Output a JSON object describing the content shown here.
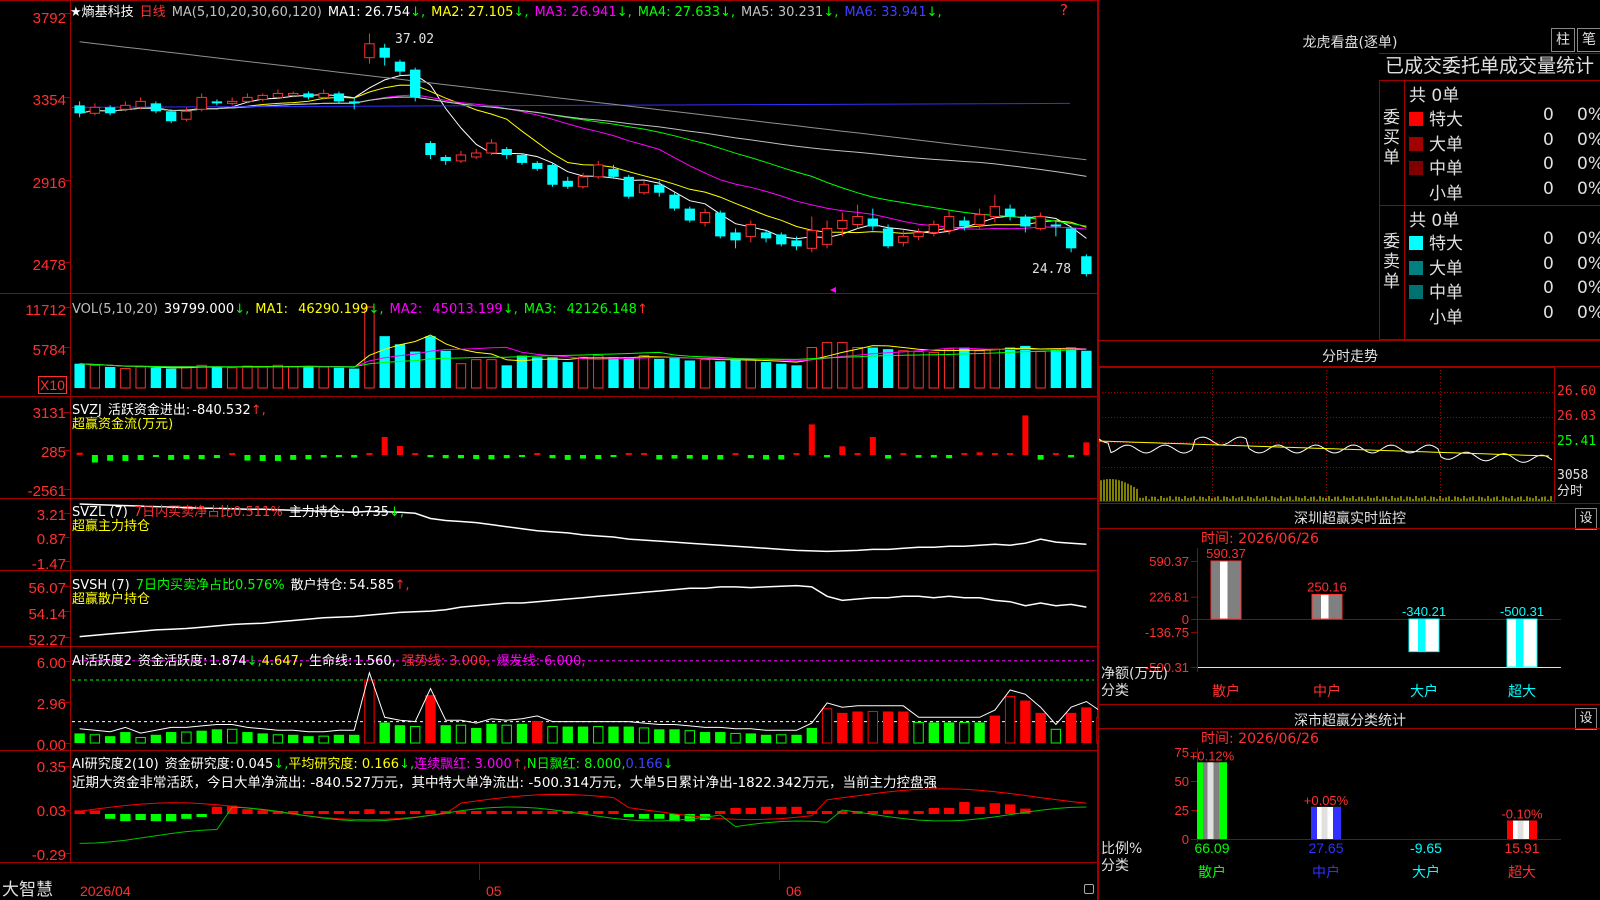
{
  "stock": {
    "star": "★",
    "name": "熵基科技",
    "period": "日线",
    "ma_spec": "MA(5,10,20,30,60,120)",
    "ma": [
      {
        "label": "MA1:",
        "value": "26.754",
        "arrow": "↓",
        "color": "#ffffff"
      },
      {
        "label": "MA2:",
        "value": "27.105",
        "arrow": "↓",
        "color": "#ffff00"
      },
      {
        "label": "MA3:",
        "value": "26.941",
        "arrow": "↓",
        "color": "#ff00ff"
      },
      {
        "label": "MA4:",
        "value": "27.633",
        "arrow": "↓",
        "color": "#00ff00"
      },
      {
        "label": "MA5:",
        "value": "30.231",
        "arrow": "↓",
        "color": "#c0c0c0"
      },
      {
        "label": "MA6:",
        "value": "33.941",
        "arrow": "↓",
        "color": "#4040ff"
      }
    ],
    "question_mark": "?",
    "high_mark": "37.02",
    "low_mark": "24.78"
  },
  "price_axis": [
    "3792",
    "3354",
    "2916",
    "2478"
  ],
  "vol": {
    "header": "VOL(5,10,20)",
    "value": "39799.000",
    "ma1": "46290.199",
    "ma2": "45013.199",
    "ma3": "42126.148",
    "axis": [
      "11712",
      "5784"
    ],
    "unit": "X10"
  },
  "svzj": {
    "name": "SVZJ",
    "label": "活跃资金进出:",
    "value": "-840.532",
    "arrow": "↑,",
    "sub": "超赢资金流(万元)",
    "axis": [
      "3131",
      "285",
      "-2561"
    ]
  },
  "svzl": {
    "name": "SVZL (7)",
    "desc": "7日内买卖净占比0.511%",
    "label": "主力持仓:",
    "value": "-0.735",
    "arrow": "↓,",
    "sub": "超赢主力持仓",
    "axis": [
      "3.21",
      "0.87",
      "-1.47"
    ]
  },
  "svsh": {
    "name": "SVSH (7)",
    "desc": "7日内买卖净占比0.576%",
    "label": "散户持仓:",
    "value": "54.585",
    "arrow": "↑,",
    "sub": "超赢散户持仓",
    "axis": [
      "56.07",
      "54.14",
      "52.27"
    ]
  },
  "ai1": {
    "name": "AI活跃度2",
    "label": "资金活跃度:",
    "value": "1.874",
    "arrow": "↓,",
    "v2": "4.647,",
    "life_label": "生命线:",
    "life": "1.560,",
    "strong": "强势线: 3.000,",
    "burst": "爆发线: 6.000,",
    "axis": [
      "6.00",
      "2.96",
      "0.00"
    ]
  },
  "ai2": {
    "name": "AI研究度2(10)",
    "label": "资金研究度:",
    "value": "0.045",
    "arrow": "↓,",
    "avg": "平均研究度: 0.166",
    "avg_arrow": "↓,",
    "cont": "连续飘红: 3.000",
    "cont_arrow": "↑,",
    "nday": "N日飘红: 8.000,",
    "last": "0.166",
    "last_arrow": "↓",
    "comment": "近期大资金非常活跃，今日大单净流出: -840.527万元，其中特大单净流出: -500.314万元，大单5日累计净出-1822.342万元，当前主力控盘强",
    "axis": [
      "0.35",
      "0.03",
      "-0.29"
    ]
  },
  "time_axis": {
    "logo": "大智慧",
    "labels": [
      "2026/04",
      "05",
      "06"
    ]
  },
  "lhb": {
    "title": "龙虎看盘(逐单)",
    "btn_bar": "柱",
    "btn_pen": "笔",
    "tabs_text": "已成交委托单成交量统计",
    "buy_label": "委买单",
    "sell_label": "委卖单",
    "buy_total": "共 0单",
    "sell_total": "共 0单",
    "buy_rows": [
      {
        "name": "特大",
        "count": "0",
        "pct": "0%",
        "color": "#ff0000"
      },
      {
        "name": "大单",
        "count": "0",
        "pct": "0%",
        "color": "#a00000"
      },
      {
        "name": "中单",
        "count": "0",
        "pct": "0%",
        "color": "#800000"
      },
      {
        "name": "小单",
        "count": "0",
        "pct": "0%",
        "color": ""
      }
    ],
    "sell_rows": [
      {
        "name": "特大",
        "count": "0",
        "pct": "0%",
        "color": "#00ffff"
      },
      {
        "name": "大单",
        "count": "0",
        "pct": "0%",
        "color": "#008080"
      },
      {
        "name": "中单",
        "count": "0",
        "pct": "0%",
        "color": "#007070"
      },
      {
        "name": "小单",
        "count": "0",
        "pct": "0%",
        "color": ""
      }
    ]
  },
  "fenshi": {
    "title": "分时走势",
    "axis": [
      "26.60",
      "26.03",
      "25.41"
    ],
    "vol": "3058",
    "unit": "分时"
  },
  "monitor": {
    "title": "深圳超赢实时监控",
    "btn": "设",
    "time": "时间: 2026/06/26",
    "axis": [
      "590.37",
      "226.81",
      "0",
      "-136.75",
      "-500.31"
    ],
    "ylabel": "净额(万元)",
    "xlabel": "分类",
    "bars": [
      {
        "cat": "散户",
        "value": 590.37,
        "label": "590.37",
        "cat_color": "#ff3030"
      },
      {
        "cat": "中户",
        "value": 250.16,
        "label": "250.16",
        "cat_color": "#ff3030"
      },
      {
        "cat": "大户",
        "value": -340.21,
        "label": "-340.21",
        "cat_color": "#00ffff"
      },
      {
        "cat": "超大",
        "value": -500.31,
        "label": "-500.31",
        "cat_color": "#00ffff"
      }
    ]
  },
  "classify": {
    "title": "深市超赢分类统计",
    "btn": "设",
    "time": "时间: 2026/06/26",
    "axis": [
      "75",
      "50",
      "25",
      "0"
    ],
    "ylabel": "比例%",
    "xlabel": "分类",
    "bars": [
      {
        "cat": "散户",
        "value": 66.09,
        "label": "66.09",
        "top": "+0.12%",
        "cat_color": "#00ff00"
      },
      {
        "cat": "中户",
        "value": 27.65,
        "label": "27.65",
        "top": "+0.05%",
        "cat_color": "#3030ff"
      },
      {
        "cat": "大户",
        "value": 0,
        "label": "-9.65",
        "top": "",
        "cat_color": "#00ffff"
      },
      {
        "cat": "超大",
        "value": 15.91,
        "label": "15.91",
        "top": "-0.10%",
        "cat_color": "#ff3030"
      }
    ]
  },
  "chart_data": {
    "type": "candlestick",
    "ylim": [
      24.0,
      38.0
    ],
    "candles": [
      [
        33.4,
        33.0,
        33.6,
        32.8
      ],
      [
        33.0,
        33.3,
        33.5,
        32.9
      ],
      [
        33.3,
        33.0,
        33.4,
        32.9
      ],
      [
        33.2,
        33.4,
        33.6,
        33.1
      ],
      [
        33.3,
        33.6,
        33.8,
        33.2
      ],
      [
        33.5,
        33.1,
        33.6,
        33.0
      ],
      [
        33.1,
        32.6,
        33.2,
        32.5
      ],
      [
        32.7,
        33.1,
        33.3,
        32.6
      ],
      [
        33.2,
        33.8,
        34.0,
        33.1
      ],
      [
        33.6,
        33.5,
        33.7,
        33.4
      ],
      [
        33.5,
        33.6,
        33.8,
        33.4
      ],
      [
        33.6,
        33.8,
        34.0,
        33.5
      ],
      [
        33.7,
        33.9,
        34.0,
        33.6
      ],
      [
        33.8,
        34.0,
        34.2,
        33.7
      ],
      [
        33.9,
        34.0,
        34.1,
        33.8
      ],
      [
        34.0,
        33.8,
        34.1,
        33.7
      ],
      [
        33.8,
        34.0,
        34.2,
        33.7
      ],
      [
        34.0,
        33.6,
        34.1,
        33.5
      ],
      [
        33.6,
        33.5,
        33.8,
        33.2
      ],
      [
        35.8,
        36.5,
        37.02,
        35.5
      ],
      [
        36.3,
        35.8,
        36.5,
        35.4
      ],
      [
        35.6,
        35.1,
        35.7,
        34.9
      ],
      [
        35.2,
        33.8,
        35.3,
        33.6
      ],
      [
        31.5,
        30.9,
        31.6,
        30.7
      ],
      [
        30.8,
        30.6,
        30.9,
        30.4
      ],
      [
        30.6,
        30.9,
        31.1,
        30.5
      ],
      [
        30.8,
        31.0,
        31.2,
        30.7
      ],
      [
        31.0,
        31.5,
        31.7,
        30.9
      ],
      [
        31.2,
        30.9,
        31.3,
        30.7
      ],
      [
        30.9,
        30.5,
        31.0,
        30.4
      ],
      [
        30.5,
        30.2,
        30.6,
        30.1
      ],
      [
        30.4,
        29.4,
        30.5,
        29.3
      ],
      [
        29.6,
        29.3,
        29.8,
        29.2
      ],
      [
        29.3,
        29.8,
        30.0,
        29.2
      ],
      [
        29.8,
        30.4,
        30.6,
        29.7
      ],
      [
        30.2,
        29.8,
        30.4,
        29.7
      ],
      [
        29.8,
        28.8,
        29.9,
        28.7
      ],
      [
        29.0,
        29.4,
        29.6,
        28.9
      ],
      [
        29.4,
        29.0,
        29.6,
        28.8
      ],
      [
        28.9,
        28.2,
        29.0,
        28.1
      ],
      [
        28.2,
        27.6,
        28.3,
        27.5
      ],
      [
        27.5,
        28.0,
        28.2,
        27.3
      ],
      [
        28.0,
        26.8,
        28.1,
        26.7
      ],
      [
        27.0,
        26.6,
        27.2,
        26.2
      ],
      [
        26.8,
        27.4,
        27.6,
        26.5
      ],
      [
        27.0,
        26.7,
        27.1,
        26.5
      ],
      [
        26.9,
        26.4,
        27.0,
        26.3
      ],
      [
        26.6,
        26.3,
        26.8,
        26.1
      ],
      [
        26.2,
        27.1,
        27.8,
        26.0
      ],
      [
        26.4,
        27.2,
        27.6,
        26.2
      ],
      [
        27.2,
        27.6,
        28.0,
        26.8
      ],
      [
        27.4,
        27.8,
        28.4,
        27.2
      ],
      [
        27.7,
        27.3,
        28.2,
        27.1
      ],
      [
        27.2,
        26.3,
        27.4,
        26.2
      ],
      [
        26.5,
        26.8,
        27.1,
        26.3
      ],
      [
        26.8,
        27.0,
        27.2,
        26.6
      ],
      [
        27.0,
        27.4,
        27.6,
        26.8
      ],
      [
        27.1,
        27.8,
        28.1,
        26.9
      ],
      [
        27.6,
        27.3,
        27.8,
        27.1
      ],
      [
        27.4,
        27.9,
        28.2,
        27.2
      ],
      [
        27.8,
        28.3,
        28.9,
        27.5
      ],
      [
        28.2,
        27.8,
        28.4,
        27.6
      ],
      [
        27.8,
        27.3,
        27.9,
        27.0
      ],
      [
        27.2,
        27.8,
        28.0,
        27.1
      ],
      [
        27.4,
        27.3,
        27.6,
        26.8
      ],
      [
        27.2,
        26.2,
        27.3,
        26.0
      ],
      [
        25.8,
        24.9,
        25.9,
        24.78
      ]
    ],
    "volume": [
      30,
      28,
      26,
      24,
      26,
      25,
      24,
      26,
      28,
      26,
      25,
      27,
      26,
      28,
      26,
      27,
      26,
      25,
      24,
      100,
      64,
      54,
      45,
      64,
      46,
      30,
      35,
      35,
      28,
      40,
      38,
      38,
      32,
      38,
      40,
      38,
      38,
      40,
      36,
      37,
      34,
      35,
      33,
      35,
      35,
      32,
      30,
      28,
      50,
      56,
      56,
      50,
      50,
      48,
      46,
      45,
      44,
      48,
      50,
      46,
      48,
      50,
      52,
      45,
      48,
      50,
      46
    ],
    "svzj": [
      130,
      -420,
      -320,
      -330,
      -280,
      -80,
      -270,
      -230,
      -230,
      -170,
      80,
      -310,
      -330,
      -330,
      -270,
      -240,
      -140,
      -120,
      -140,
      0,
      1000,
      500,
      0,
      -120,
      -180,
      -180,
      -220,
      -240,
      -180,
      -40,
      0,
      -180,
      -270,
      -200,
      -220,
      -110,
      0,
      0,
      -250,
      -200,
      -200,
      -250,
      -250,
      0,
      -180,
      -250,
      -250,
      0,
      1700,
      -130,
      480,
      0,
      1000,
      -200,
      0,
      -150,
      -140,
      -180,
      0,
      150,
      0,
      0,
      2200,
      -260,
      0,
      -130,
      700,
      -420,
      -300
    ],
    "svzl": [
      3.2,
      3.15,
      3.1,
      3.05,
      3.0,
      2.95,
      2.9,
      2.85,
      2.8,
      2.8,
      2.75,
      2.7,
      2.7,
      2.65,
      2.6,
      2.55,
      2.5,
      2.45,
      2.4,
      2.5,
      2.45,
      2.4,
      2.3,
      1.8,
      1.6,
      1.5,
      1.4,
      1.2,
      1.0,
      0.8,
      0.6,
      0.5,
      0.4,
      0.2,
      0.1,
      0.0,
      -0.2,
      -0.3,
      -0.4,
      -0.5,
      -0.6,
      -0.7,
      -0.8,
      -0.9,
      -1.0,
      -1.1,
      -1.2,
      -1.3,
      -1.35,
      -1.4,
      -1.35,
      -1.3,
      -1.2,
      -1.2,
      -1.1,
      -1.0,
      -1.0,
      -0.9,
      -0.9,
      -0.8,
      -0.7,
      -0.8,
      -0.6,
      -0.2,
      -0.5,
      -0.6,
      -0.7,
      -0.8,
      -0.735
    ],
    "svsh": [
      52.3,
      52.4,
      52.5,
      52.6,
      52.7,
      52.8,
      52.85,
      52.9,
      53.0,
      53.1,
      53.2,
      53.25,
      53.3,
      53.4,
      53.5,
      53.6,
      53.7,
      53.75,
      53.8,
      53.9,
      54.0,
      54.1,
      54.15,
      54.2,
      54.3,
      54.5,
      54.6,
      54.7,
      54.8,
      54.8,
      54.9,
      55.0,
      55.1,
      55.2,
      55.3,
      55.4,
      55.5,
      55.6,
      55.7,
      55.8,
      55.9,
      55.9,
      56.0,
      56.0,
      55.95,
      56.0,
      56.05,
      56.1,
      56.0,
      55.3,
      55.0,
      55.1,
      55.2,
      55.2,
      55.3,
      55.3,
      55.2,
      55.3,
      55.2,
      55.2,
      55.0,
      54.9,
      54.6,
      54.8,
      54.6,
      54.7,
      54.5,
      54.6,
      54.585
    ],
    "ai_active": [
      0.7,
      0.6,
      0.5,
      0.8,
      0.4,
      0.6,
      0.8,
      0.8,
      0.9,
      1.0,
      1.0,
      0.8,
      0.7,
      0.6,
      0.6,
      0.5,
      0.5,
      0.6,
      0.6,
      4.6,
      1.5,
      1.3,
      1.2,
      3.5,
      1.3,
      1.3,
      1.1,
      1.4,
      1.3,
      1.4,
      1.6,
      1.2,
      1.2,
      1.2,
      1.2,
      1.2,
      1.2,
      1.1,
      1.0,
      1.0,
      0.9,
      0.8,
      0.8,
      0.7,
      0.7,
      0.6,
      0.6,
      0.6,
      1.1,
      2.5,
      2.2,
      2.3,
      2.3,
      2.3,
      2.3,
      1.5,
      1.5,
      1.5,
      1.5,
      1.5,
      2.0,
      3.4,
      3.1,
      2.2,
      1.0,
      2.2,
      2.6,
      1.874
    ],
    "ai_research": [
      0.03,
      0.03,
      -0.04,
      -0.06,
      -0.05,
      -0.06,
      -0.06,
      -0.04,
      -0.01,
      0.06,
      0.07,
      0.04,
      0.03,
      0.02,
      0.02,
      0.0,
      0.0,
      0.0,
      0.0,
      0.04,
      0.0,
      0.0,
      0.02,
      0.03,
      0.0,
      0.02,
      0.02,
      0.02,
      0.0,
      0.02,
      0.0,
      0.0,
      0.0,
      0.0,
      0.0,
      0.0,
      -0.02,
      -0.04,
      -0.04,
      -0.06,
      -0.06,
      -0.05,
      0.02,
      0.05,
      0.05,
      0.06,
      0.06,
      0.06,
      0.0,
      0.0,
      0.0,
      0.02,
      0.02,
      0.03,
      0.03,
      0.02,
      0.05,
      0.05,
      0.1,
      0.06,
      0.09,
      0.08,
      0.045
    ]
  }
}
